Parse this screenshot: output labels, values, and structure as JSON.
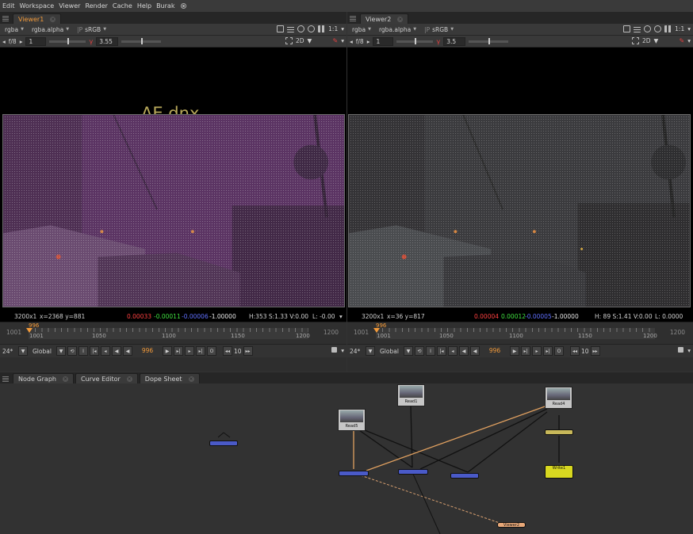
{
  "menu": {
    "items": [
      "Edit",
      "Workspace",
      "Viewer",
      "Render",
      "Cache",
      "Help",
      "Burak"
    ]
  },
  "viewers": [
    {
      "tab": "Viewer1",
      "channel": "rgba",
      "alpha": "rgba.alpha",
      "colorspace": "sRGB",
      "ratio": "1:1",
      "fstop": "f/8",
      "frame_field": "1",
      "gain": "3.55",
      "mode": "2D",
      "overlay_text": "AE.dnx",
      "info": {
        "res": "3200x1",
        "coords": "x=2368 y=881",
        "r": "0.00033",
        "g": "-0.00011",
        "b": "-0.00006",
        "a": "-1.00000",
        "hsv": "H:353 S:1.33 V:0.00",
        "l": "L: -0.00"
      },
      "timeline": {
        "start": "1001",
        "end": "1200",
        "current": "996",
        "labels": [
          "1001",
          "1050",
          "1100",
          "1150",
          "1200"
        ]
      },
      "playback": {
        "fps": "24*",
        "scope": "Global",
        "frame": "996",
        "step": "10"
      }
    },
    {
      "tab": "Viewer2",
      "channel": "rgba",
      "alpha": "rgba.alpha",
      "colorspace": "sRGB",
      "ratio": "1:1",
      "fstop": "f/8",
      "frame_field": "1",
      "gain": "3.5",
      "mode": "2D",
      "overlay_text": "",
      "info": {
        "res": "3200x1",
        "coords": "x=36 y=817",
        "r": "0.00004",
        "g": "0.00012",
        "b": "-0.00005",
        "a": "-1.00000",
        "hsv": "H: 89 S:1.41 V:0.00",
        "l": "L: 0.0000"
      },
      "timeline": {
        "start": "1001",
        "end": "1200",
        "current": "996",
        "labels": [
          "1001",
          "1050",
          "1100",
          "1150",
          "1200"
        ]
      },
      "playback": {
        "fps": "24*",
        "scope": "Global",
        "frame": "996",
        "step": "10"
      }
    }
  ],
  "panel_tabs": [
    "Node Graph",
    "Curve Editor",
    "Dope Sheet"
  ],
  "nodes": {
    "read1": "Read1",
    "read4": "Read4",
    "read5": "Read5",
    "write1": "Write1",
    "viewer2": "Viewer2",
    "timeoffset": "TimeOffset1"
  },
  "colors": {
    "accent": "#f29a3a",
    "node_blue": "#4a5ac8",
    "node_write": "#d8d820"
  }
}
